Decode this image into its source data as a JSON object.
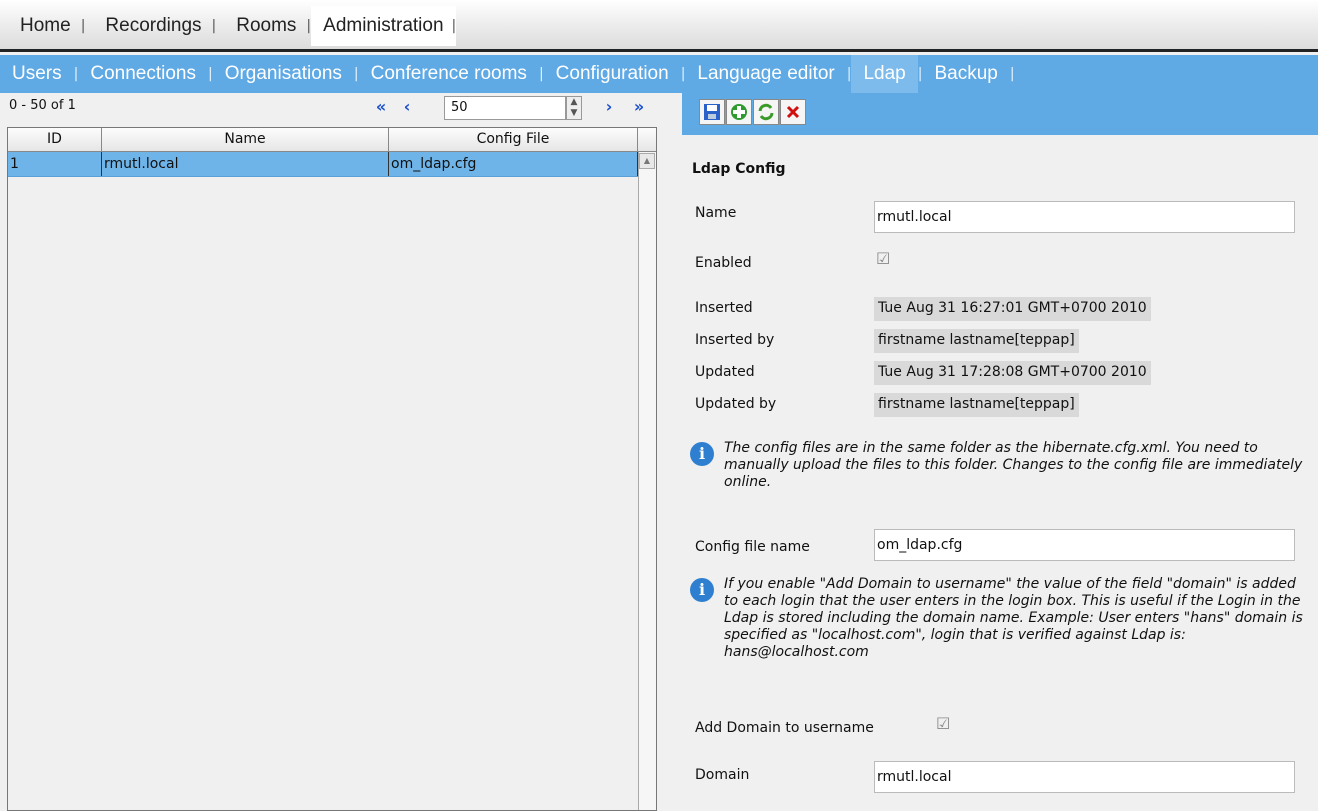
{
  "topnav": {
    "tabs": [
      "Home",
      "Recordings",
      "Rooms",
      "Administration"
    ],
    "active": "Administration"
  },
  "subnav": {
    "tabs": [
      "Users",
      "Connections",
      "Organisations",
      "Conference rooms",
      "Configuration",
      "Language editor",
      "Ldap",
      "Backup"
    ],
    "active": "Ldap"
  },
  "list": {
    "count_text": "0 - 50 of 1",
    "page_size": "50",
    "columns": [
      "ID",
      "Name",
      "Config File"
    ],
    "rows": [
      {
        "id": "1",
        "name": "rmutl.local",
        "config_file": "om_ldap.cfg"
      }
    ]
  },
  "toolbar": {
    "buttons": [
      "save-icon",
      "add-icon",
      "refresh-icon",
      "delete-icon"
    ]
  },
  "form": {
    "title": "Ldap Config",
    "name_label": "Name",
    "name_value": "rmutl.local",
    "enabled_label": "Enabled",
    "enabled_checked": true,
    "inserted_label": "Inserted",
    "inserted_value": "Tue Aug 31 16:27:01 GMT+0700 2010",
    "inserted_by_label": "Inserted by",
    "inserted_by_value": "firstname lastname[teppap]",
    "updated_label": "Updated",
    "updated_value": "Tue Aug 31 17:28:08 GMT+0700 2010",
    "updated_by_label": "Updated by",
    "updated_by_value": "firstname lastname[teppap]",
    "info1": "The config files are in the same folder as the hibernate.cfg.xml. You need to manually upload the files to this folder. Changes to the config file are immediately online.",
    "config_file_label": "Config file name",
    "config_file_value": "om_ldap.cfg",
    "info2": "If you enable \"Add Domain to username\" the value of the field \"domain\" is added to each login that the user enters in the login box. This is useful if the Login in the Ldap is stored including the domain name. Example: User enters \"hans\" domain is specified as \"localhost.com\", login that is verified against Ldap is: hans@localhost.com",
    "add_domain_label": "Add Domain to username",
    "add_domain_checked": true,
    "domain_label": "Domain",
    "domain_value": "rmutl.local"
  }
}
